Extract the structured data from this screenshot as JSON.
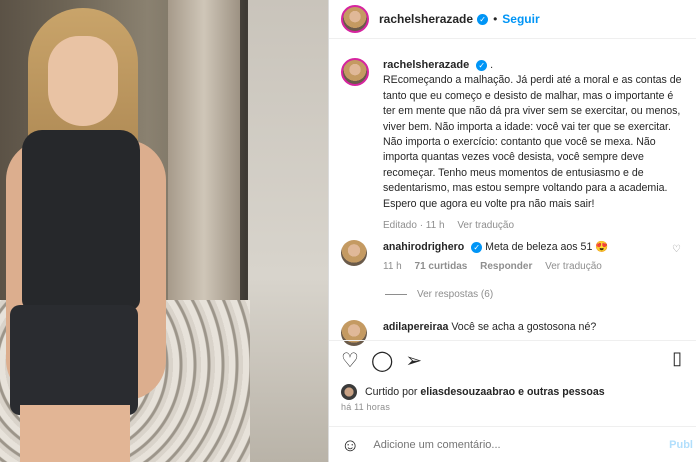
{
  "header": {
    "username": "rachelsherazade",
    "separator": "•",
    "follow_label": "Seguir"
  },
  "post": {
    "username": "rachelsherazade",
    "trail": ".",
    "caption": "REcomeçando a malhação. Já perdi até a moral e as contas de tanto que eu começo e desisto de malhar, mas o importante é ter em mente que não dá pra viver sem se exercitar, ou menos, viver bem. Não importa a idade: você vai ter que se exercitar. Não importa o exercício: contanto que você se mexa. Não importa quantas vezes você desista, você sempre deve recomeçar. Tenho meus momentos de entusiasmo e de sedentarismo, mas estou sempre voltando para a academia. Espero que agora eu volte pra não mais sair!",
    "edited": "Editado · 11 h",
    "translate": "Ver tradução"
  },
  "comments": [
    {
      "username": "anahirodrighero",
      "text": "Meta de beleza aos 51 😍",
      "time": "11 h",
      "likes": "71 curtidas",
      "reply": "Responder",
      "translate": "Ver tradução"
    },
    {
      "username": "adilapereiraa",
      "text": "Você se acha a gostosona né?"
    }
  ],
  "view_replies": "Ver respostas (6)",
  "liked_by": {
    "prefix": "Curtido por",
    "user": "eliasdesouzaabrao",
    "suffix": "e outras pessoas"
  },
  "timestamp": "há 11 horas",
  "composer": {
    "placeholder": "Adicione um comentário...",
    "publish": "Publ"
  },
  "icons": {
    "like": "heart-icon",
    "comment": "comment-icon",
    "share": "share-icon",
    "save": "bookmark-icon",
    "emoji": "emoji-icon",
    "verified": "verified-badge-icon"
  },
  "colors": {
    "accent": "#0095f6",
    "muted": "#8e8e8e",
    "text": "#262626"
  }
}
